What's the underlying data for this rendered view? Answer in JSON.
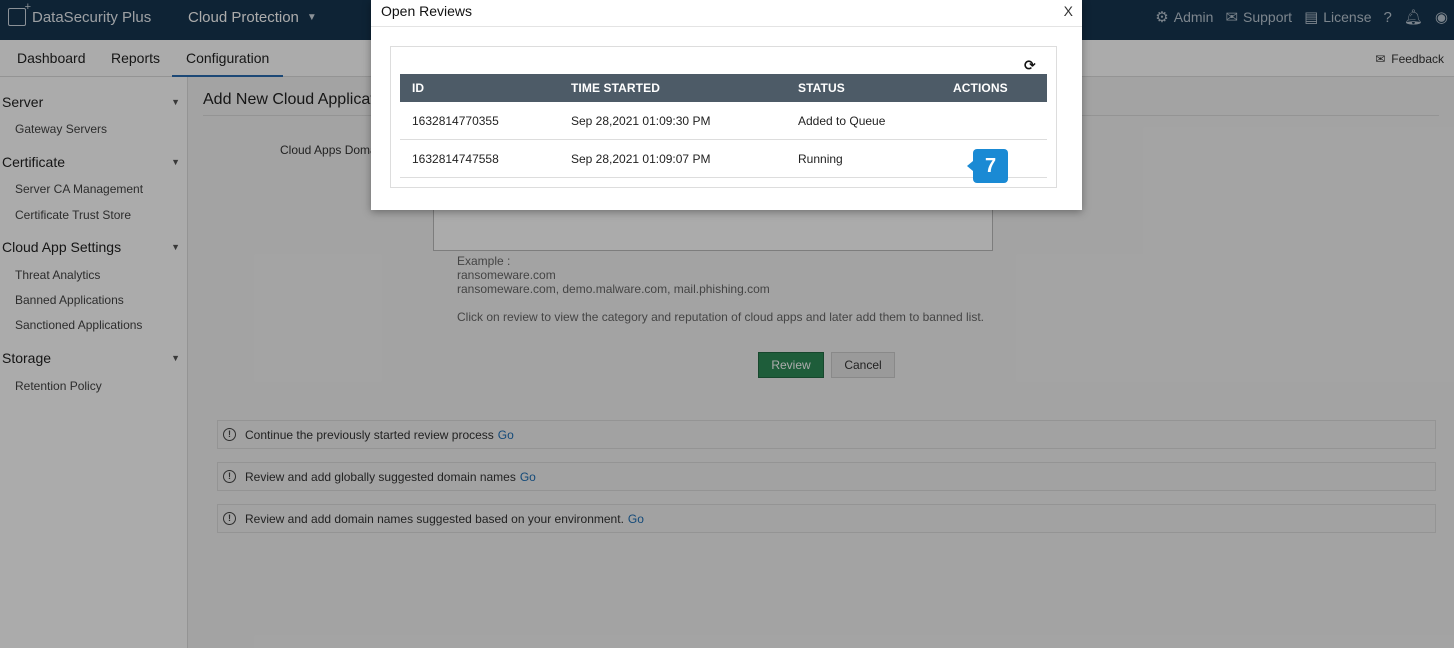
{
  "header": {
    "brand": "DataSecurity Plus",
    "module": "Cloud Protection",
    "right_items": [
      {
        "icon": "admin-gear-icon",
        "label": "Admin"
      },
      {
        "icon": "support-chat-icon",
        "label": "Support"
      },
      {
        "icon": "license-doc-icon",
        "label": "License"
      }
    ]
  },
  "nav": {
    "tabs": [
      "Dashboard",
      "Reports",
      "Configuration"
    ],
    "active_tab": "Configuration",
    "feedback": "Feedback"
  },
  "sidebar": {
    "sections": [
      {
        "title": "Server",
        "items": [
          "Gateway Servers"
        ]
      },
      {
        "title": "Certificate",
        "items": [
          "Server CA Management",
          "Certificate Trust Store"
        ]
      },
      {
        "title": "Cloud App Settings",
        "items": [
          "Threat Analytics",
          "Banned Applications",
          "Sanctioned Applications"
        ]
      },
      {
        "title": "Storage",
        "items": [
          "Retention Policy"
        ]
      }
    ]
  },
  "main": {
    "title": "Add New Cloud Applicati",
    "field_label": "Cloud Apps Doma",
    "hint_lines": [
      "Example :",
      "ransomeware.com",
      "ransomeware.com, demo.malware.com, mail.phishing.com",
      "Click on review to view the category and reputation of cloud apps and later add them to banned list."
    ],
    "review_button": "Review",
    "cancel_button": "Cancel",
    "notices": [
      {
        "text": "Continue the previously started review process",
        "link": "Go"
      },
      {
        "text": "Review and add globally suggested domain names",
        "link": "Go"
      },
      {
        "text": "Review and add domain names suggested based on your environment.",
        "link": "Go"
      }
    ]
  },
  "modal": {
    "title": "Open Reviews",
    "close": "X",
    "columns": [
      "ID",
      "TIME STARTED",
      "STATUS",
      "ACTIONS"
    ],
    "rows": [
      {
        "id": "1632814770355",
        "time": "Sep 28,2021 01:09:30 PM",
        "status": "Added to Queue"
      },
      {
        "id": "1632814747558",
        "time": "Sep 28,2021 01:09:07 PM",
        "status": "Running"
      }
    ]
  },
  "step_badge": "7",
  "colors": {
    "header_bg": "#16354f",
    "accent_blue": "#1a8ad4",
    "review_green": "#2e8b57",
    "table_header": "#4d5b67"
  }
}
